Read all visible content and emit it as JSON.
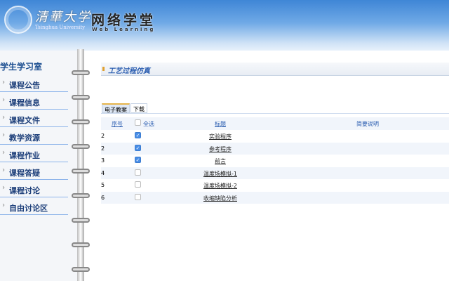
{
  "header": {
    "university": "清華大学",
    "university_en": "Tsinghua University",
    "site": "网络学堂",
    "site_en": "Web Learning"
  },
  "sidebar": {
    "title": "学生学习室",
    "items": [
      {
        "label": "课程公告"
      },
      {
        "label": "课程信息"
      },
      {
        "label": "课程文件"
      },
      {
        "label": "教学资源"
      },
      {
        "label": "课程作业"
      },
      {
        "label": "课程答疑"
      },
      {
        "label": "课程讨论"
      },
      {
        "label": "自由讨论区"
      }
    ]
  },
  "main": {
    "title": "工艺过程仿真",
    "tabs": [
      {
        "label": "电子教案"
      },
      {
        "label": "下载"
      }
    ],
    "columns": {
      "index": "序号",
      "select_all": "全选",
      "title": "标题",
      "desc": "简要说明"
    },
    "rows": [
      {
        "index": "2",
        "checked": true,
        "title": "实验程序"
      },
      {
        "index": "2",
        "checked": true,
        "title": "参考程序"
      },
      {
        "index": "3",
        "checked": true,
        "title": "前言"
      },
      {
        "index": "4",
        "checked": false,
        "title": "温度场模拟-1"
      },
      {
        "index": "5",
        "checked": false,
        "title": "温度场模拟-2"
      },
      {
        "index": "6",
        "checked": false,
        "title": "收缩缺陷分析"
      }
    ]
  }
}
